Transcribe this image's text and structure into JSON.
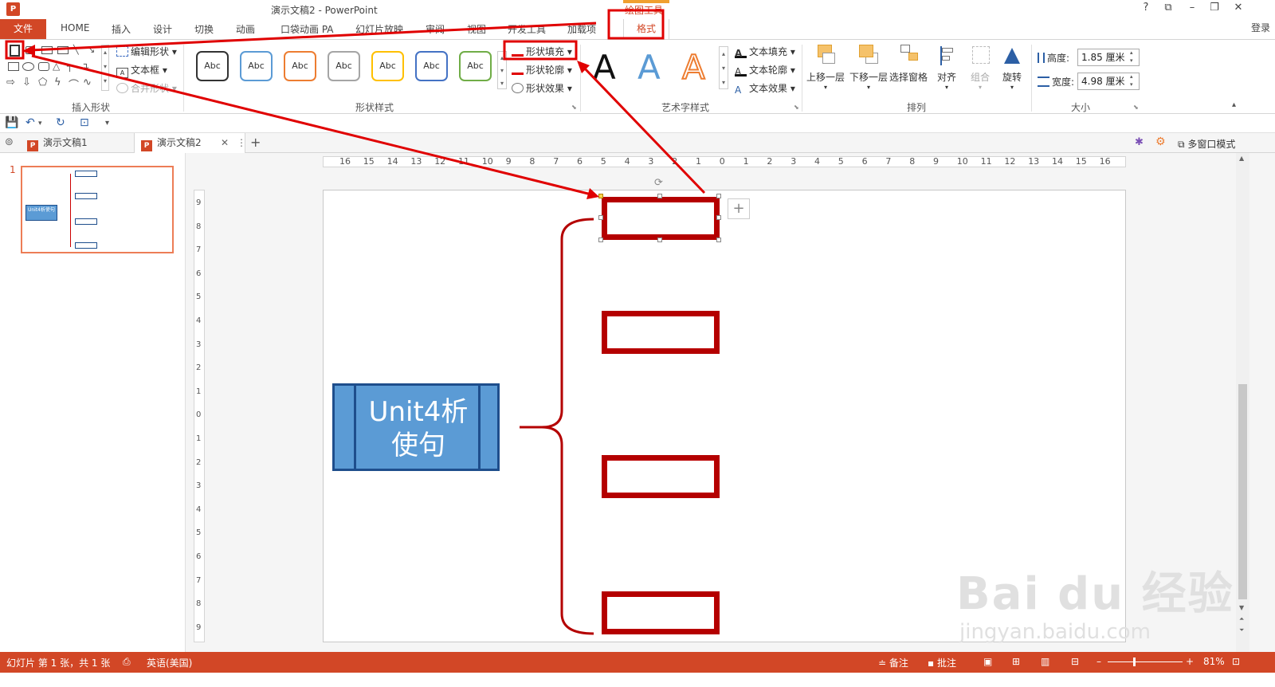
{
  "window": {
    "title": "演示文稿2 - PowerPoint",
    "context_tab_group": "绘图工具",
    "app_icon": "P"
  },
  "tabs": {
    "file": "文件",
    "items": [
      "HOME",
      "插入",
      "设计",
      "切换",
      "动画",
      "口袋动画 PA",
      "幻灯片放映",
      "审阅",
      "视图",
      "开发工具",
      "加载项"
    ],
    "format": "格式",
    "login": "登录"
  },
  "ribbon": {
    "insert_shapes": {
      "label": "插入形状",
      "edit_shape": "编辑形状",
      "text_box": "文本框",
      "merge_shapes": "合并形状"
    },
    "shape_styles": {
      "label": "形状样式",
      "swatch_text": "Abc",
      "swatch_colors": [
        "#333333",
        "#5b9bd5",
        "#ed7d31",
        "#a5a5a5",
        "#ffc000",
        "#4472c4",
        "#70ad47"
      ],
      "fill": "形状填充",
      "outline": "形状轮廓",
      "effects": "形状效果"
    },
    "wordart_styles": {
      "label": "艺术字样式",
      "letter": "A",
      "text_fill": "文本填充",
      "text_outline": "文本轮廓",
      "text_effects": "文本效果"
    },
    "arrange": {
      "label": "排列",
      "bring_forward": "上移一层",
      "send_backward": "下移一层",
      "selection_pane": "选择窗格",
      "align": "对齐",
      "group": "组合",
      "rotate": "旋转"
    },
    "size": {
      "label": "大小",
      "height_label": "高度:",
      "height_value": "1.85 厘米",
      "width_label": "宽度:",
      "width_value": "4.98 厘米"
    }
  },
  "doc_tabs": {
    "tab1": "演示文稿1",
    "tab2": "演示文稿2",
    "multi_window": "多窗口模式"
  },
  "thumbnails": {
    "slide_number": "1",
    "main_label": "Unit4析使句"
  },
  "ruler": {
    "h_ticks": [
      "16",
      "15",
      "14",
      "13",
      "12",
      "11",
      "10",
      "9",
      "8",
      "7",
      "6",
      "5",
      "4",
      "3",
      "2",
      "1",
      "0",
      "1",
      "2",
      "3",
      "4",
      "5",
      "6",
      "7",
      "8",
      "9",
      "10",
      "11",
      "12",
      "13",
      "14",
      "15",
      "16"
    ],
    "v_ticks": [
      "9",
      "8",
      "7",
      "6",
      "5",
      "4",
      "3",
      "2",
      "1",
      "0",
      "1",
      "2",
      "3",
      "4",
      "5",
      "6",
      "7",
      "8",
      "9"
    ]
  },
  "slide": {
    "main_box_line1": "Unit4析",
    "main_box_line2": "使句"
  },
  "statusbar": {
    "slide_info": "幻灯片 第 1 张，共 1 张",
    "language": "英语(美国)",
    "notes": "备注",
    "comments": "批注",
    "zoom": "81%"
  },
  "watermark": {
    "brand": "Bai du 经验",
    "url": "jingyan.baidu.com"
  },
  "colors": {
    "accent": "#d24726",
    "annotation": "#e00000",
    "box_border": "#b40000",
    "main_box_fill": "#5b9bd5"
  }
}
